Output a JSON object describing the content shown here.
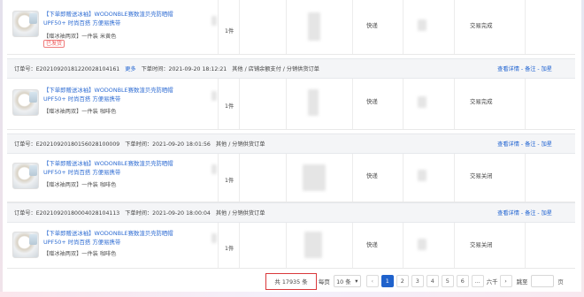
{
  "orders": [
    {
      "header": null,
      "product_title": "【下单即赠送冰袖】WODONBLE赛数渲贝壳防晒帽 UPF50+ 时尚百搭 方便易携带",
      "spec": "【赠冰袖两双】一件装 米黄色",
      "tag": "已发货",
      "qty": "1件",
      "shipping": "快递",
      "status": "交易完成"
    },
    {
      "header": {
        "order_no": "订单号：E20210920181220028104161",
        "more": "更多",
        "time": "下单时间：2021-09-20 18:12:21",
        "source": "其他 / 店铺余额支付 / 分销供货订单",
        "actions": "查看详情 - 备注 - 加星"
      },
      "product_title": "【下单即赠送冰袖】WODONBLE赛数渲贝壳防晒帽 UPF50+ 时尚百搭 方便易携带",
      "spec": "【赠冰袖两双】一件装 咖啡色",
      "tag": "",
      "qty": "1件",
      "shipping": "快递",
      "status": "交易完成"
    },
    {
      "header": {
        "order_no": "订单号：E20210920180156028100009",
        "more": "",
        "time": "下单时间：2021-09-20 18:01:56",
        "source": "其他 / 分销供货订单",
        "actions": "查看详情 - 备注 - 加星"
      },
      "product_title": "【下单即赠送冰袖】WODONBLE赛数渲贝壳防晒帽 UPF50+ 时尚百搭 方便易携带",
      "spec": "【赠冰袖两双】一件装 咖啡色",
      "tag": "",
      "qty": "1件",
      "shipping": "快递",
      "status": "交易关闭"
    },
    {
      "header": {
        "order_no": "订单号：E20210920180004028104113",
        "more": "",
        "time": "下单时间：2021-09-20 18:00:04",
        "source": "其他 / 分销供货订单",
        "actions": "查看详情 - 备注 - 加星"
      },
      "product_title": "【下单即赠送冰袖】WODONBLE赛数渲贝壳防晒帽 UPF50+ 时尚百搭 方便易携带",
      "spec": "【赠冰袖两双】一件装 咖啡色",
      "tag": "",
      "qty": "1件",
      "shipping": "快递",
      "status": "交易关闭"
    }
  ],
  "pagination": {
    "total": "共 17935 条",
    "per_page_label": "每页",
    "page_size": "10 条",
    "size_caret": "▾",
    "prev": "‹",
    "pages": [
      "1",
      "2",
      "3",
      "4",
      "5",
      "6"
    ],
    "ellipsis": "...",
    "last_fragment": "六千",
    "next": "›",
    "jump_label": "跳至",
    "jump_value": "",
    "jump_suffix": "页"
  },
  "colors": {
    "link": "#1a5fd0",
    "active_page": "#1f62cc",
    "highlight_box": "#d9383b",
    "tag": "#e55555"
  }
}
